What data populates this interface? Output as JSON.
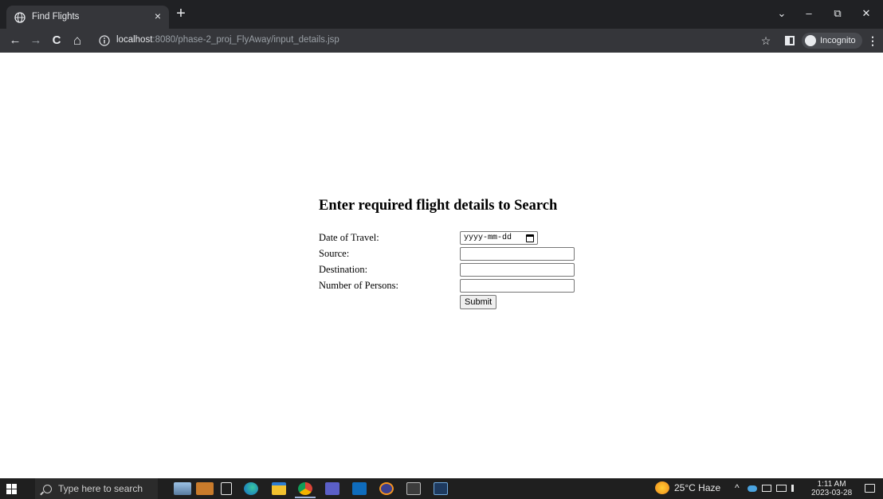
{
  "browser": {
    "tab": {
      "title": "Find Flights",
      "close_glyph": "×"
    },
    "new_tab_glyph": "+",
    "window_controls": {
      "minimize": "–",
      "restore": "⧉",
      "close": "✕",
      "dropdown": "⌄"
    },
    "nav": {
      "back": "←",
      "forward": "→",
      "reload": "C",
      "home": "⌂"
    },
    "url": {
      "host": "localhost",
      "path": ":8080/phase-2_proj_FlyAway/input_details.jsp"
    },
    "star_glyph": "☆",
    "incognito_label": "Incognito",
    "menu_glyph": "⋮"
  },
  "form": {
    "heading": "Enter required flight details to Search",
    "fields": {
      "date_label": "Date of Travel:",
      "date_placeholder": "yyyy-mm-dd",
      "source_label": "Source:",
      "destination_label": "Destination:",
      "persons_label": "Number of Persons:"
    },
    "submit_label": "Submit"
  },
  "taskbar": {
    "search_placeholder": "Type here to search",
    "weather": "25°C  Haze",
    "tray_chevron": "^",
    "time": "1:11 AM",
    "date": "2023-03-28"
  },
  "icons": [
    "globe-icon",
    "info-icon",
    "star-icon",
    "side-panel-icon",
    "incognito-icon",
    "calendar-icon",
    "windows-start-icon",
    "search-icon",
    "task-view-icon",
    "edge-icon",
    "file-explorer-icon",
    "chrome-icon",
    "teams-icon",
    "outlook-icon",
    "eclipse-icon",
    "terminal-icon",
    "remote-desktop-icon",
    "weather-icon",
    "notification-icon"
  ]
}
